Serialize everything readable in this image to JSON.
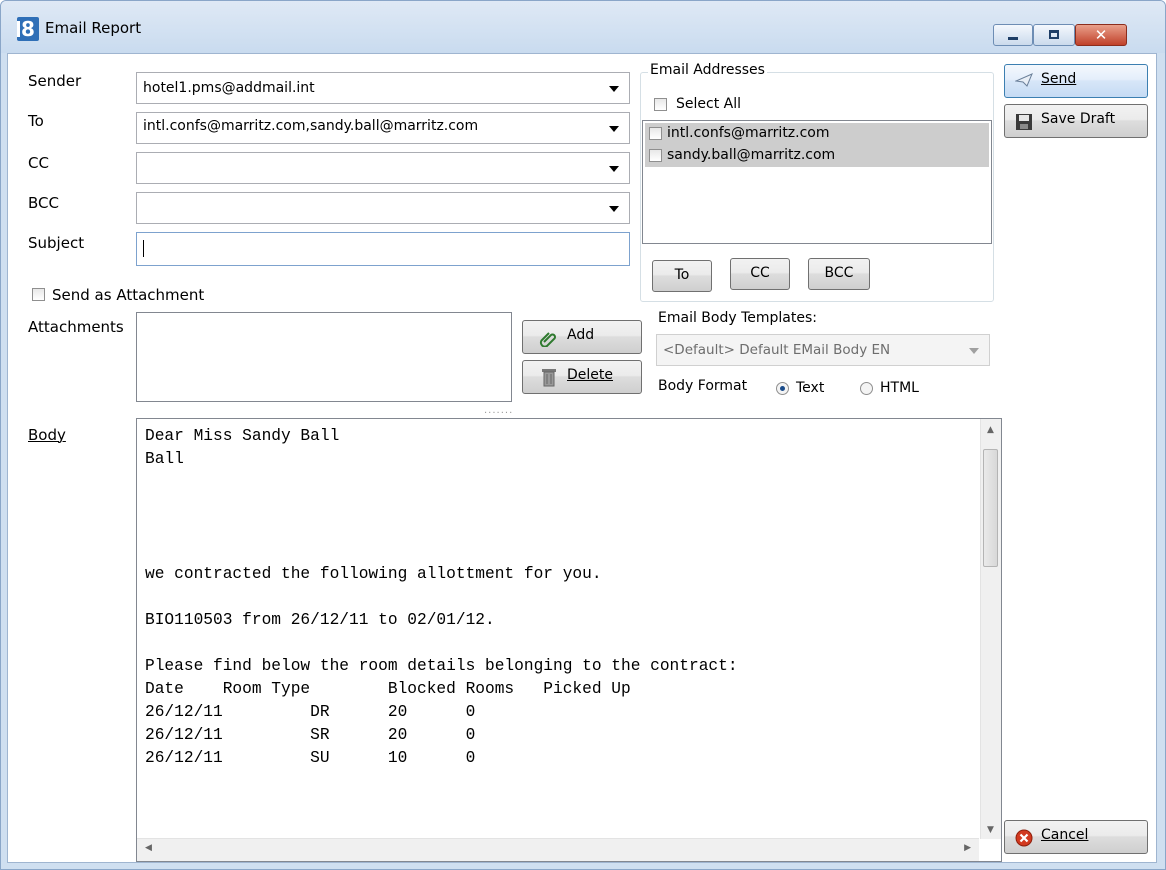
{
  "window": {
    "title": "Email Report"
  },
  "sender": {
    "label": "Sender",
    "value": "hotel1.pms@addmail.int"
  },
  "to": {
    "label": "To",
    "value": "intl.confs@marritz.com,sandy.ball@marritz.com"
  },
  "cc": {
    "label": "CC",
    "value": ""
  },
  "bcc": {
    "label": "BCC",
    "value": ""
  },
  "subject": {
    "label": "Subject",
    "value": ""
  },
  "send_as_attachment": {
    "label": "Send as Attachment",
    "checked": false
  },
  "attachments": {
    "label": "Attachments",
    "add_label": "Add",
    "delete_label": "Delete"
  },
  "email_addresses": {
    "title": "Email Addresses",
    "select_all_label": "Select All",
    "items": [
      "intl.confs@marritz.com",
      "sandy.ball@marritz.com"
    ],
    "buttons": {
      "to": "To",
      "cc": "CC",
      "bcc": "BCC"
    }
  },
  "templates": {
    "label": "Email Body Templates:",
    "value": "<Default> Default EMail Body EN"
  },
  "body_format": {
    "label": "Body Format",
    "options": [
      "Text",
      "HTML"
    ],
    "selected": "Text"
  },
  "body": {
    "label": "Body",
    "text": "Dear Miss Sandy Ball\nBall\n\n\n\n\nwe contracted the following allottment for you.\n\nBIO110503 from 26/12/11 to 02/01/12.\n\nPlease find below the room details belonging to the contract:\nDate    Room Type        Blocked Rooms   Picked Up\n26/12/11         DR      20      0\n26/12/11         SR      20      0\n26/12/11         SU      10      0"
  },
  "actions": {
    "send": "Send",
    "save_draft": "Save Draft",
    "cancel": "Cancel"
  },
  "colors": {
    "titlebar": "#c9dbef",
    "close": "#c0412a",
    "cancel_icon": "#d2391f"
  }
}
